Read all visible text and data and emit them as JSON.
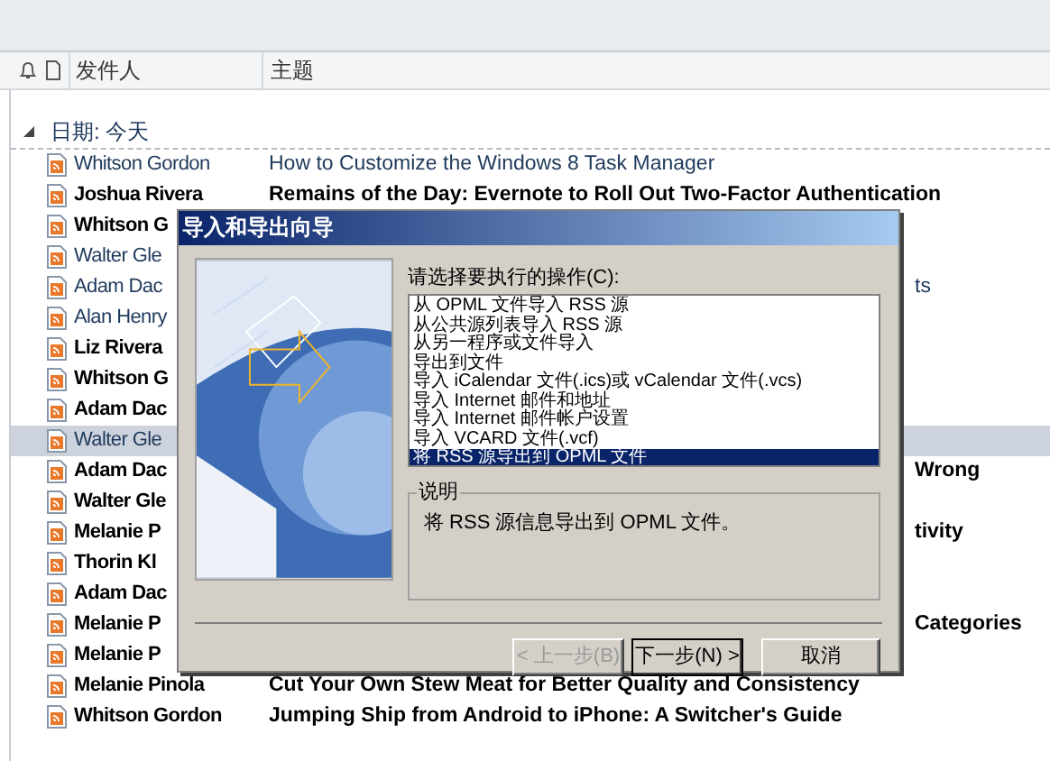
{
  "columns": [
    {
      "label": "发件人"
    },
    {
      "label": "主题"
    }
  ],
  "group": {
    "label": "日期: 今天",
    "expanded": true
  },
  "messages": [
    {
      "sender": "Whitson Gordon",
      "subject": "How to Customize the Windows 8 Task Manager",
      "unread": false,
      "selected": false
    },
    {
      "sender": "Joshua Rivera",
      "subject": "Remains of the Day: Evernote to Roll Out Two-Factor Authentication",
      "unread": true,
      "selected": false
    },
    {
      "sender": "Whitson G",
      "unread": true,
      "selected": false
    },
    {
      "sender": "Walter Gle",
      "unread": false,
      "selected": false
    },
    {
      "sender": "Adam Dac",
      "subject_tail": "ts",
      "unread": false,
      "selected": false
    },
    {
      "sender": "Alan Henry",
      "unread": false,
      "selected": false
    },
    {
      "sender": "Liz Rivera",
      "unread": true,
      "selected": false
    },
    {
      "sender": "Whitson G",
      "unread": true,
      "selected": false
    },
    {
      "sender": "Adam Dac",
      "unread": true,
      "selected": false
    },
    {
      "sender": "Walter Gle",
      "unread": false,
      "selected": true
    },
    {
      "sender": "Adam Dac",
      "subject_tail": "Wrong",
      "unread": true,
      "selected": false
    },
    {
      "sender": "Walter Gle",
      "unread": true,
      "selected": false
    },
    {
      "sender": "Melanie P",
      "subject_tail": "tivity",
      "unread": true,
      "selected": false
    },
    {
      "sender": "Thorin Kl",
      "unread": true,
      "selected": false
    },
    {
      "sender": "Adam Dac",
      "unread": true,
      "selected": false
    },
    {
      "sender": "Melanie P",
      "subject_tail": "Categories",
      "unread": true,
      "selected": false
    },
    {
      "sender": "Melanie P",
      "unread": true,
      "selected": false
    },
    {
      "sender": "Melanie Pinola",
      "subject": "Cut Your Own Stew Meat for Better Quality and Consistency",
      "unread": true,
      "selected": false
    },
    {
      "sender": "Whitson Gordon",
      "subject": "Jumping Ship from Android to iPhone: A Switcher's Guide",
      "unread": true,
      "selected": false
    }
  ],
  "dialog": {
    "title": "导入和导出向导",
    "prompt": "请选择要执行的操作(C):",
    "options": [
      {
        "label": "从 OPML 文件导入 RSS 源",
        "selected": false
      },
      {
        "label": "从公共源列表导入 RSS 源",
        "selected": false
      },
      {
        "label": "从另一程序或文件导入",
        "selected": false
      },
      {
        "label": "导出到文件",
        "selected": false
      },
      {
        "label": "导入 iCalendar 文件(.ics)或 vCalendar 文件(.vcs)",
        "selected": false
      },
      {
        "label": "导入 Internet 邮件和地址",
        "selected": false
      },
      {
        "label": "导入 Internet 邮件帐户设置",
        "selected": false
      },
      {
        "label": "导入 VCARD 文件(.vcf)",
        "selected": false
      },
      {
        "label": "将 RSS 源导出到 OPML 文件",
        "selected": true
      }
    ],
    "description_title": "说明",
    "description": "将 RSS 源信息导出到 OPML 文件。",
    "buttons": [
      {
        "label": "< 上一步(B)",
        "disabled": true,
        "default": false
      },
      {
        "label": "下一步(N) >",
        "disabled": false,
        "default": true
      },
      {
        "label": "取消",
        "disabled": false,
        "default": false
      }
    ]
  }
}
